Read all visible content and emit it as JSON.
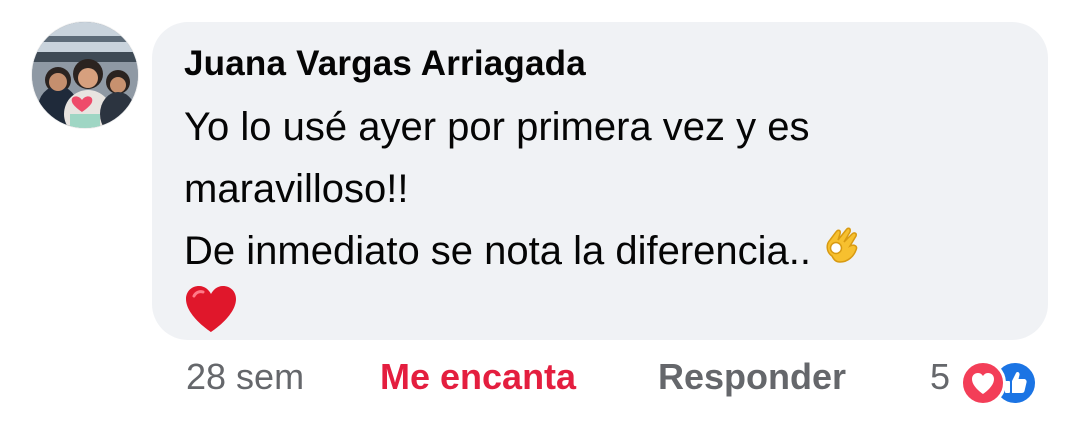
{
  "comment": {
    "author": "Juana Vargas Arriagada",
    "body_lines": [
      "Yo lo usé ayer por primera vez y es",
      "maravilloso!!",
      "De inmediato se nota la diferencia.."
    ],
    "inline_emoji": "ok-hand-emoji",
    "trailing_emoji": "red-heart-emoji",
    "timestamp": "28 sem",
    "love_label": "Me encanta",
    "reply_label": "Responder",
    "reaction_count": "5",
    "reaction_icons": [
      "love-reaction-icon",
      "like-reaction-icon"
    ]
  },
  "colors": {
    "bubble": "#f0f2f5",
    "text": "#050505",
    "muted": "#65676b",
    "love": "#e41e3f",
    "like": "#1b74e4"
  }
}
